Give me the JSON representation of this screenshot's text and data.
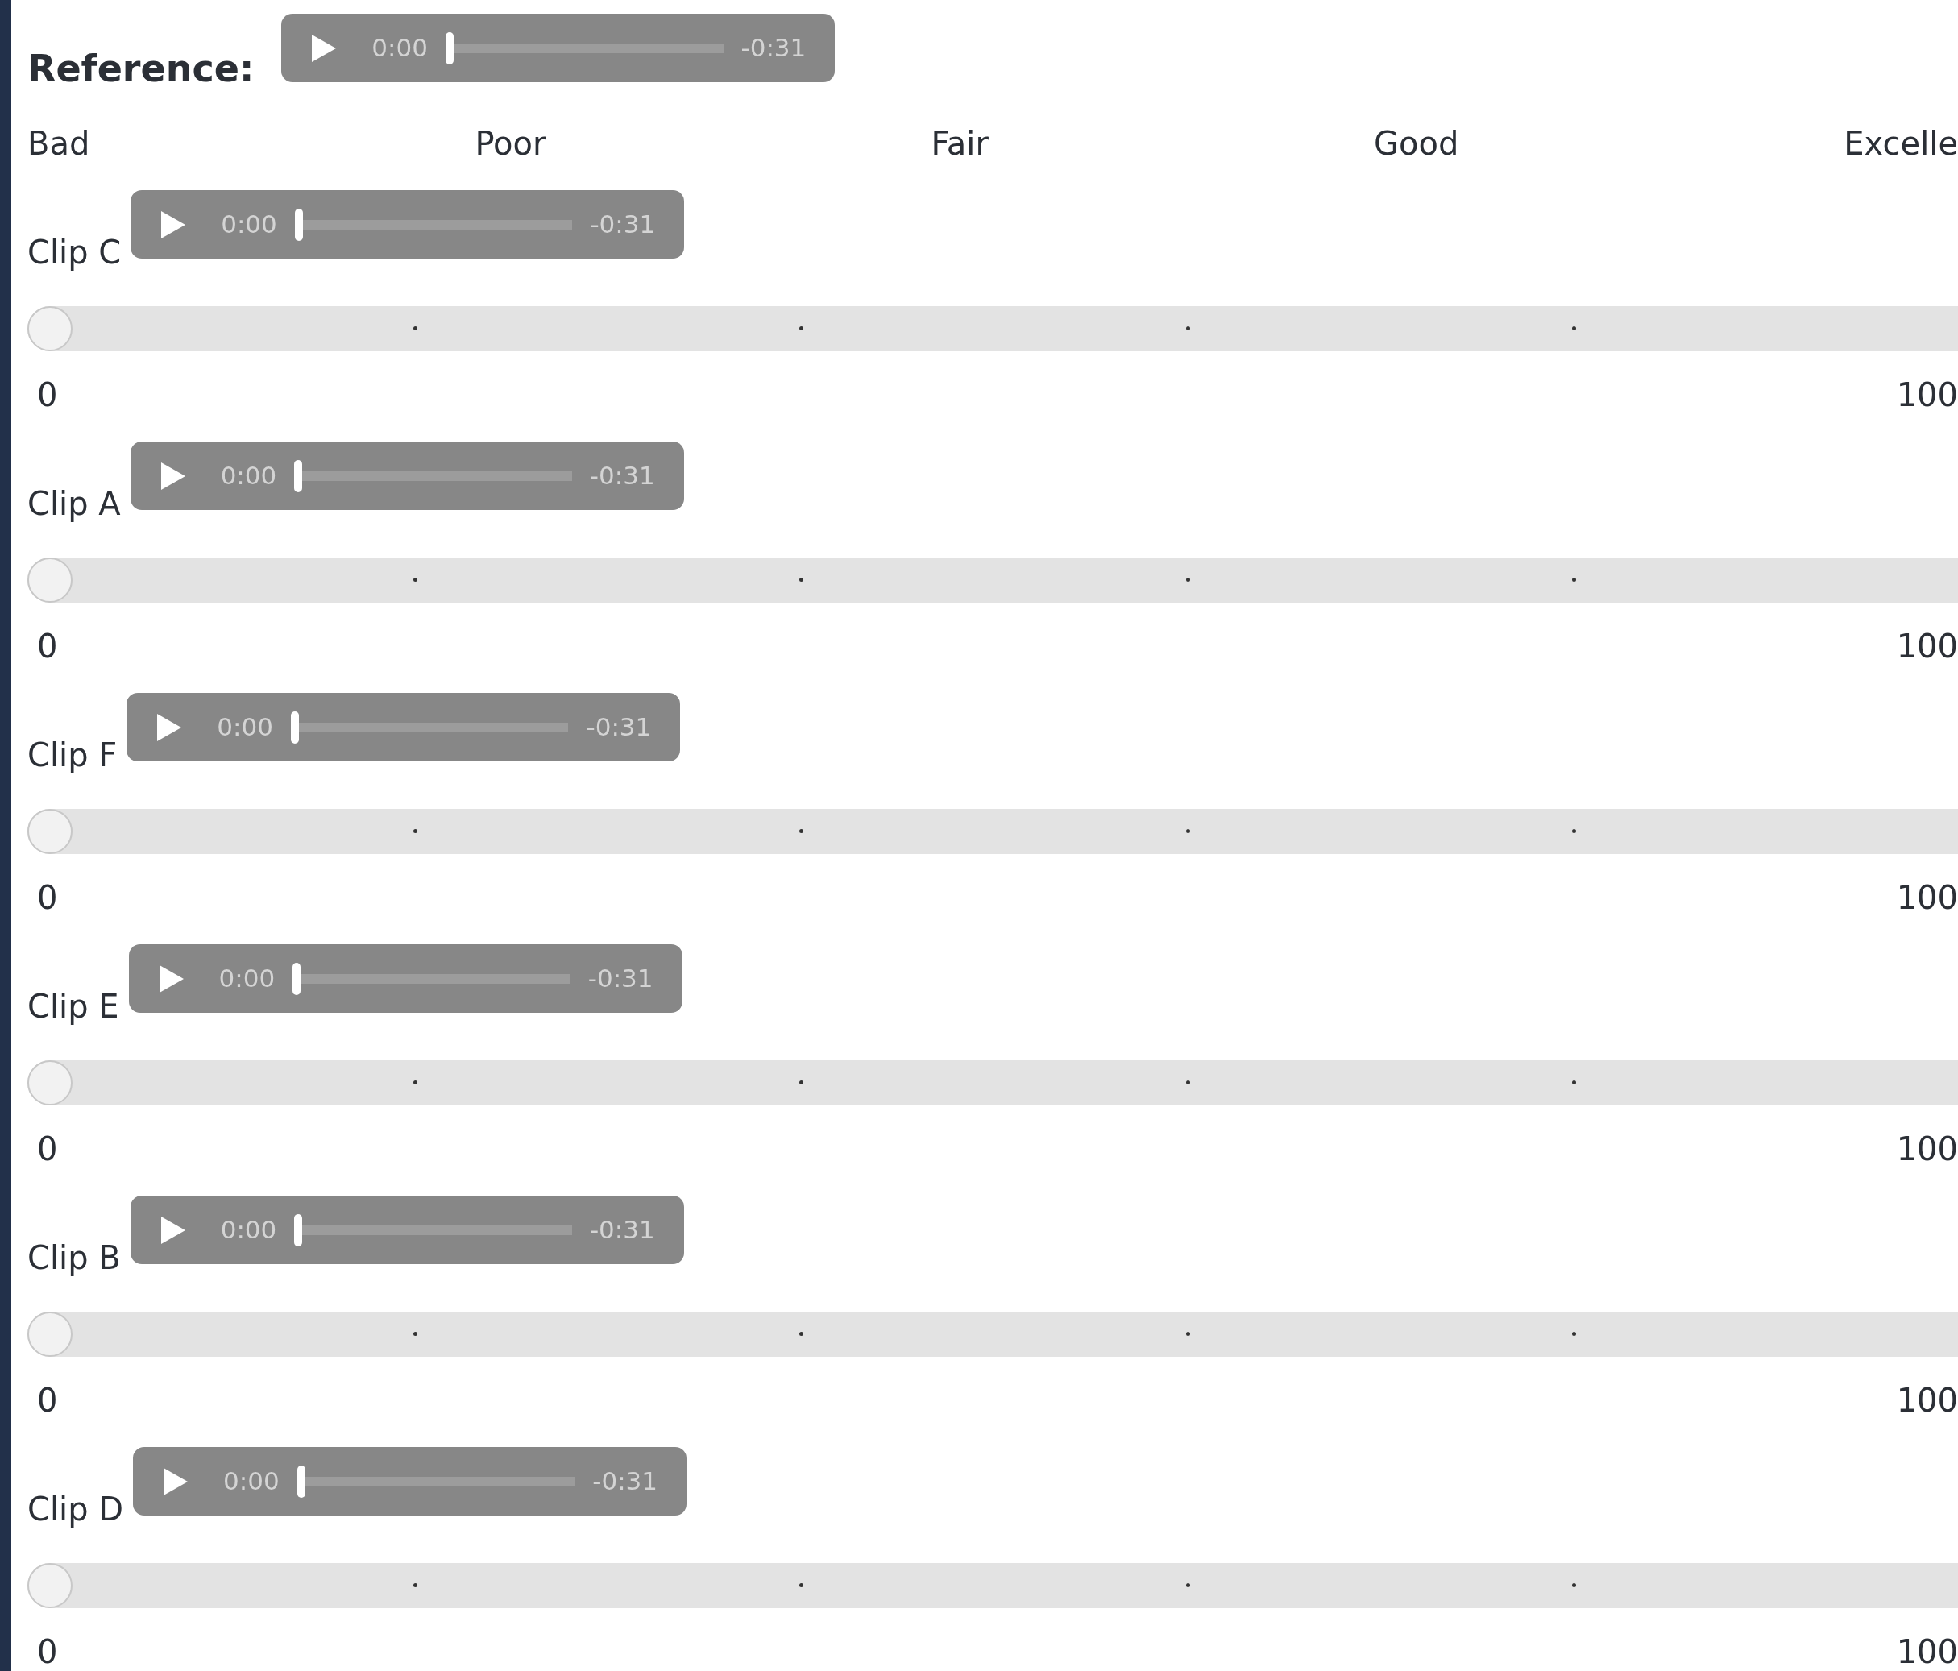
{
  "reference": {
    "label": "Reference:",
    "player": {
      "current": "0:00",
      "remaining": "-0:31",
      "level": 0
    }
  },
  "scale_labels": [
    "Bad",
    "Poor",
    "Fair",
    "Good",
    "Excelle"
  ],
  "clips": [
    {
      "label": "Clip C",
      "player": {
        "current": "0:00",
        "remaining": "-0:31",
        "level": 0
      },
      "slider": {
        "level": 0
      },
      "min_label": "0",
      "max_label": "100"
    },
    {
      "label": "Clip A",
      "player": {
        "current": "0:00",
        "remaining": "-0:31",
        "level": 0
      },
      "slider": {
        "level": 0
      },
      "min_label": "0",
      "max_label": "100"
    },
    {
      "label": "Clip F",
      "player": {
        "current": "0:00",
        "remaining": "-0:31",
        "level": 0
      },
      "slider": {
        "level": 0
      },
      "min_label": "0",
      "max_label": "100"
    },
    {
      "label": "Clip E",
      "player": {
        "current": "0:00",
        "remaining": "-0:31",
        "level": 0
      },
      "slider": {
        "level": 0
      },
      "min_label": "0",
      "max_label": "100"
    },
    {
      "label": "Clip B",
      "player": {
        "current": "0:00",
        "remaining": "-0:31",
        "level": 0
      },
      "slider": {
        "level": 0
      },
      "min_label": "0",
      "max_label": "100"
    },
    {
      "label": "Clip D",
      "player": {
        "current": "0:00",
        "remaining": "-0:31",
        "level": 0
      },
      "slider": {
        "level": 0
      },
      "min_label": "0",
      "max_label": "100"
    }
  ]
}
